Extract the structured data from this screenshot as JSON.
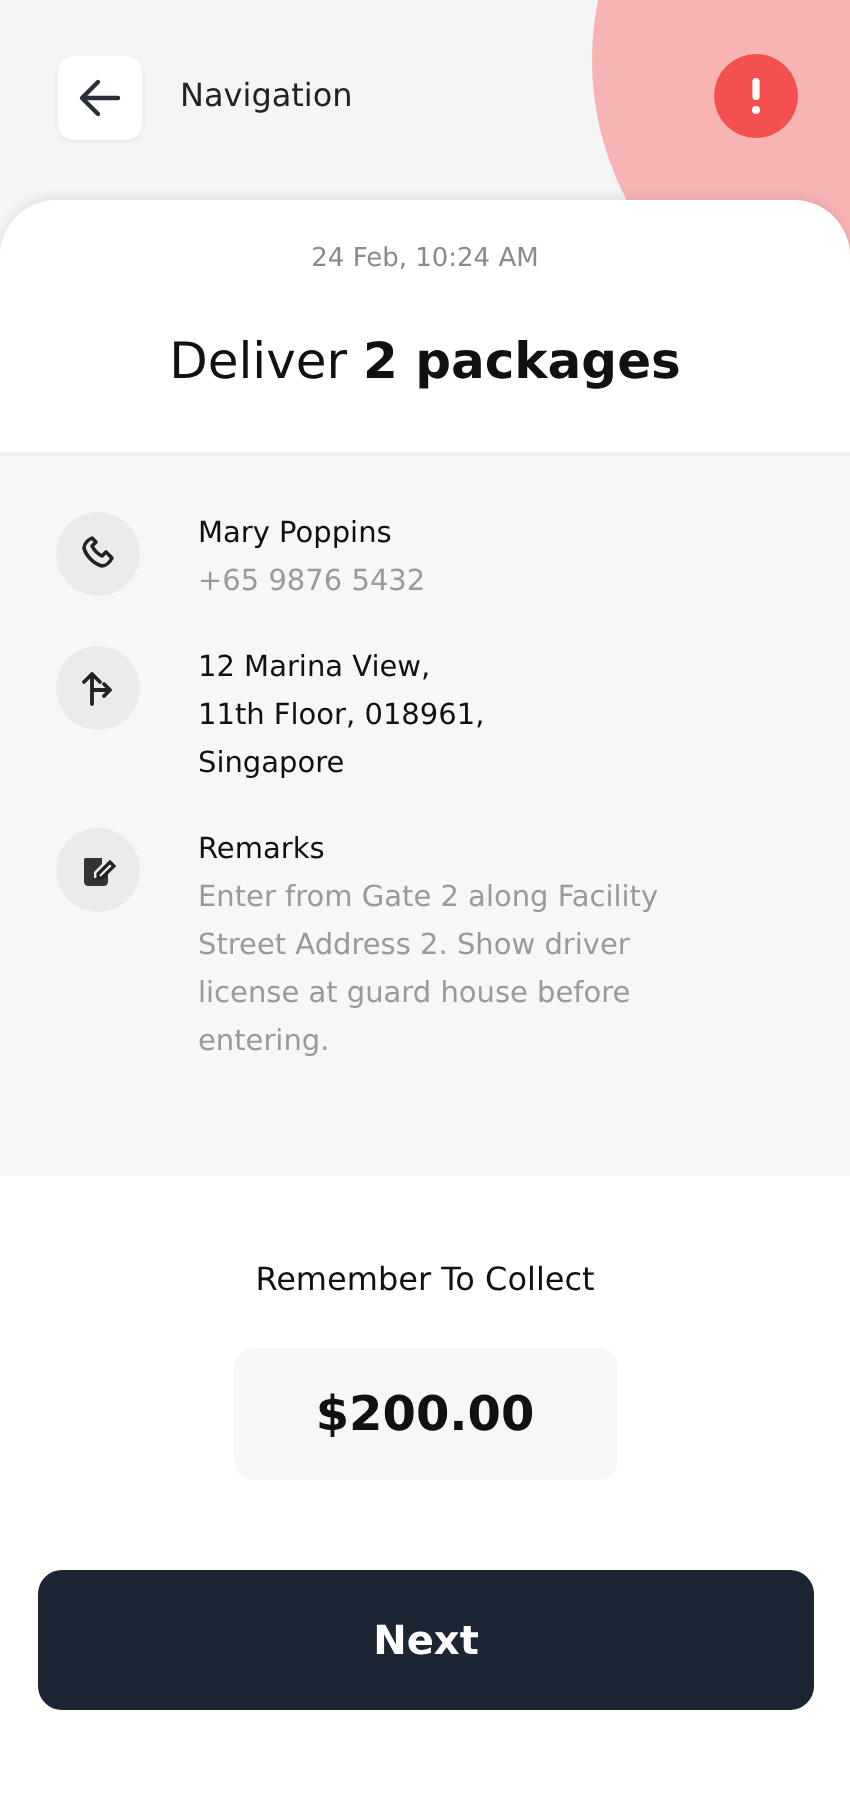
{
  "header": {
    "title": "Navigation"
  },
  "delivery": {
    "time": "24 Feb, 10:24 AM",
    "title": "Deliver **2 packages**"
  },
  "details": [
    {
      "kind": "phone",
      "title": "Mary Poppins",
      "text": "+65 9876 5432"
    },
    {
      "kind": "route",
      "title": "12 Marina View,\n11th Floor, 018961,\nSingapore"
    },
    {
      "kind": "note",
      "title": "Remarks",
      "text": "Enter from Gate 2 along Facility Street Address 2. Show driver license at guard house before entering."
    }
  ],
  "collect": {
    "label": "Remember To Collect",
    "amount": "$200.00"
  },
  "buttons": [
    {
      "label": "Next"
    }
  ]
}
